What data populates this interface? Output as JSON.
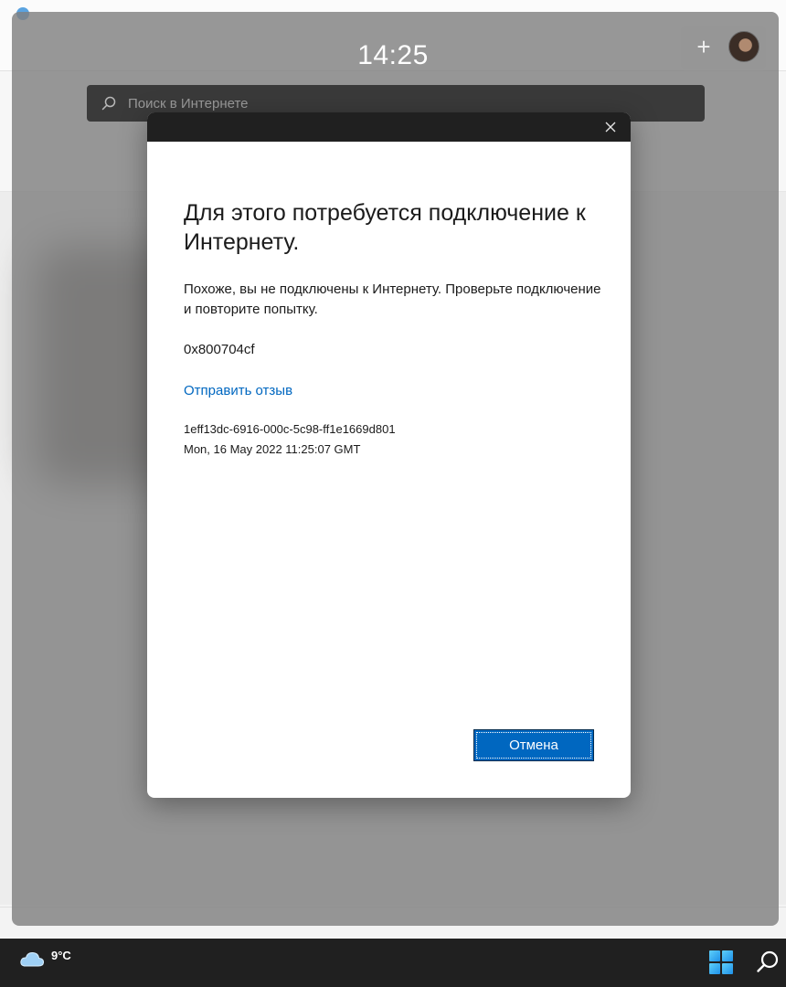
{
  "overlay": {
    "clock": "14:25",
    "search_placeholder": "Поиск в Интернете"
  },
  "dialog": {
    "heading": "Для этого потребуется подключение к Интернету.",
    "message": "Похоже, вы не подключены к Интернету. Проверьте подключение и повторите попытку.",
    "error_code": "0x800704cf",
    "feedback_link": "Отправить отзыв",
    "diagnostic_id": "1eff13dc-6916-000c-5c98-ff1e1669d801",
    "diagnostic_time": "Mon, 16 May 2022 11:25:07 GMT",
    "cancel_label": "Отмена"
  },
  "taskbar": {
    "temperature": "9°C"
  },
  "colors": {
    "accent": "#0067c0",
    "titlebar": "#202020",
    "taskbar": "#202020"
  },
  "icons": [
    "search-icon",
    "close-icon",
    "plus-icon",
    "avatar",
    "cloud-icon",
    "windows-start-icon",
    "search-icon"
  ]
}
